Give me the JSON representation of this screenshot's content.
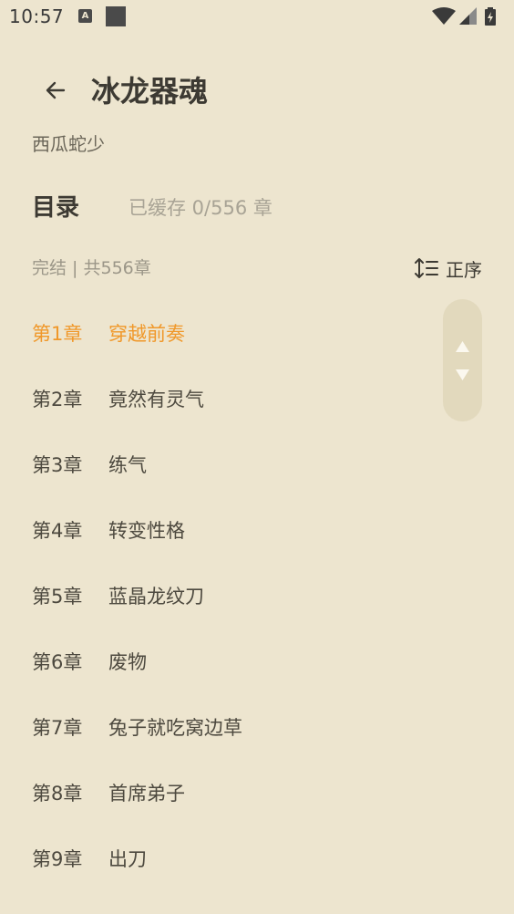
{
  "status_bar": {
    "time": "10:57",
    "notification_icons": [
      "a-notification-icon",
      "square-notification-icon"
    ],
    "right_icons": [
      "wifi-icon",
      "signal-icon",
      "battery-charging-icon"
    ]
  },
  "header": {
    "back_icon": "back-arrow-icon",
    "title": "冰龙器魂",
    "author": "西瓜蛇少"
  },
  "toc": {
    "heading": "目录",
    "cache_info": "已缓存 0/556 章",
    "book_status": "完结 | 共556章",
    "sort_label": "正序",
    "sort_icon": "sort-order-icon"
  },
  "chapters": [
    {
      "num": "第1章",
      "name": "穿越前奏",
      "current": true
    },
    {
      "num": "第2章",
      "name": "竟然有灵气",
      "current": false
    },
    {
      "num": "第3章",
      "name": "练气",
      "current": false
    },
    {
      "num": "第4章",
      "name": "转变性格",
      "current": false
    },
    {
      "num": "第5章",
      "name": "蓝晶龙纹刀",
      "current": false
    },
    {
      "num": "第6章",
      "name": "废物",
      "current": false
    },
    {
      "num": "第7章",
      "name": "兔子就吃窝边草",
      "current": false
    },
    {
      "num": "第8章",
      "name": "首席弟子",
      "current": false
    },
    {
      "num": "第9章",
      "name": "出刀",
      "current": false
    }
  ],
  "colors": {
    "background": "#ede5cf",
    "accent_current_chapter": "#f0982a",
    "scroll_pill": "#e2d9bd"
  }
}
